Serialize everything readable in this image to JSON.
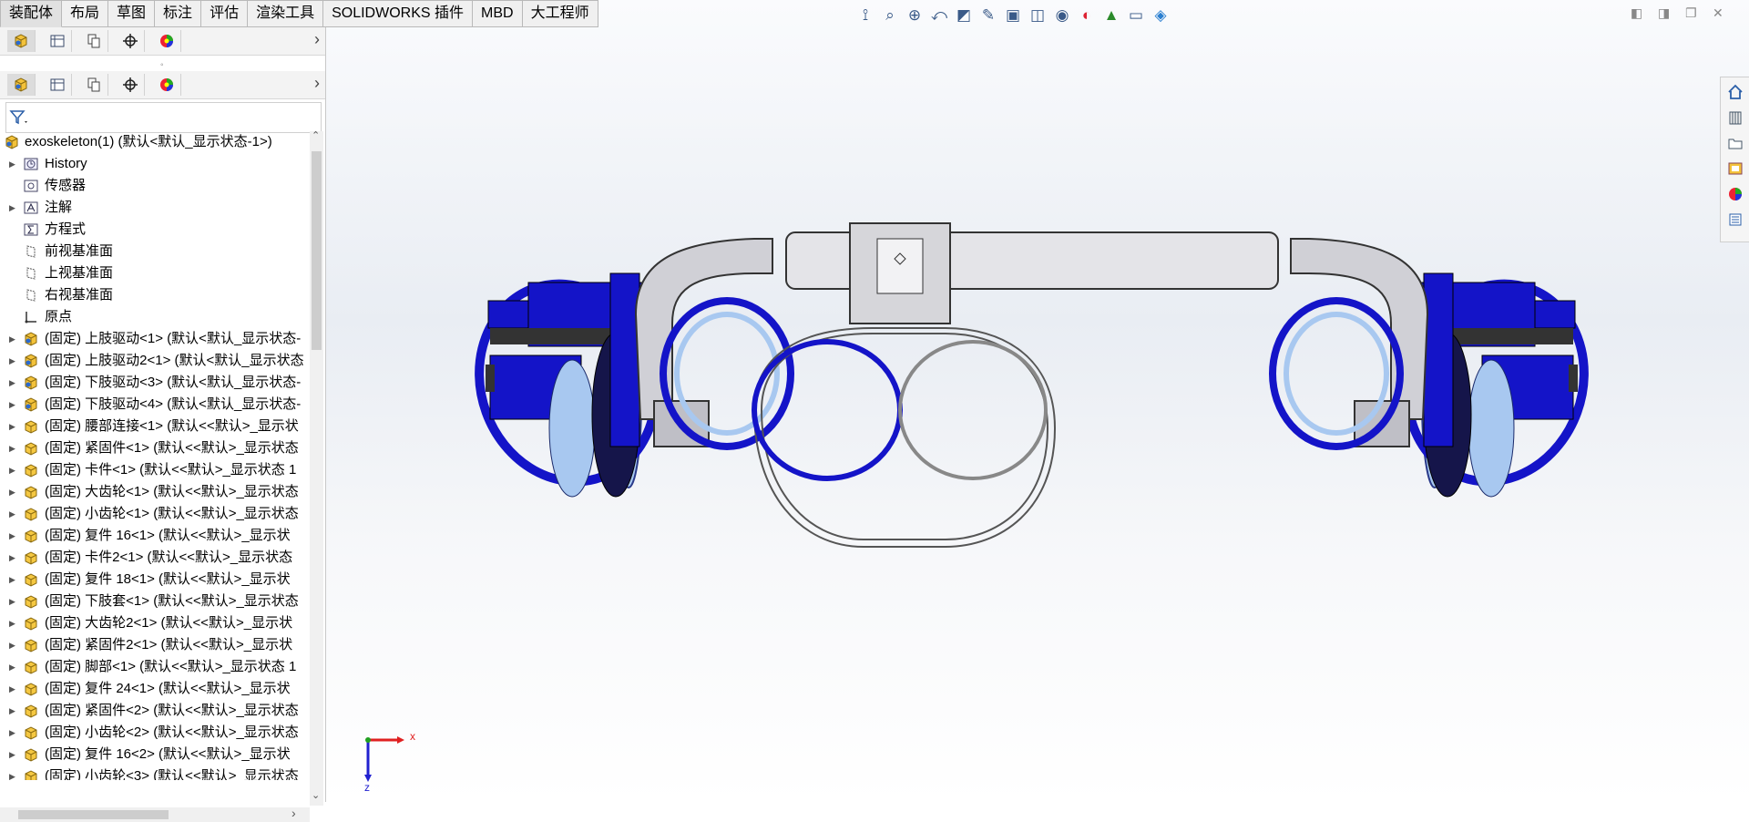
{
  "tabs": [
    "装配体",
    "布局",
    "草图",
    "标注",
    "评估",
    "渲染工具",
    "SOLIDWORKS 插件",
    "MBD",
    "大工程师"
  ],
  "manager_icons": [
    "feature-manager-icon",
    "property-manager-icon",
    "configuration-manager-icon",
    "dimxpert-icon",
    "display-manager-icon"
  ],
  "filter_icon": "filter-icon",
  "tree": {
    "root": "exoskeleton(1)  (默认<默认_显示状态-1>)",
    "items": [
      {
        "label": "History",
        "icon": "history-icon",
        "expand": true
      },
      {
        "label": "传感器",
        "icon": "sensor-icon",
        "expand": false
      },
      {
        "label": "注解",
        "icon": "annotation-icon",
        "expand": true
      },
      {
        "label": "方程式",
        "icon": "equation-icon",
        "expand": false
      },
      {
        "label": "前视基准面",
        "icon": "plane-icon",
        "expand": false
      },
      {
        "label": "上视基准面",
        "icon": "plane-icon",
        "expand": false
      },
      {
        "label": "右视基准面",
        "icon": "plane-icon",
        "expand": false
      },
      {
        "label": "原点",
        "icon": "origin-icon",
        "expand": false
      },
      {
        "label": "(固定) 上肢驱动<1> (默认<默认_显示状态-",
        "icon": "assembly-icon",
        "expand": true
      },
      {
        "label": "(固定) 上肢驱动2<1> (默认<默认_显示状态",
        "icon": "assembly-icon",
        "expand": true
      },
      {
        "label": "(固定) 下肢驱动<3> (默认<默认_显示状态-",
        "icon": "assembly-icon",
        "expand": true
      },
      {
        "label": "(固定) 下肢驱动<4> (默认<默认_显示状态-",
        "icon": "assembly-icon",
        "expand": true
      },
      {
        "label": "(固定) 腰部连接<1> (默认<<默认>_显示状",
        "icon": "part-icon",
        "expand": true
      },
      {
        "label": "(固定) 紧固件<1> (默认<<默认>_显示状态",
        "icon": "part-icon",
        "expand": true
      },
      {
        "label": "(固定) 卡件<1> (默认<<默认>_显示状态 1",
        "icon": "part-icon",
        "expand": true
      },
      {
        "label": "(固定) 大齿轮<1> (默认<<默认>_显示状态",
        "icon": "part-icon",
        "expand": true
      },
      {
        "label": "(固定) 小齿轮<1> (默认<<默认>_显示状态",
        "icon": "part-icon",
        "expand": true
      },
      {
        "label": "(固定) 复件 16<1> (默认<<默认>_显示状",
        "icon": "part-icon",
        "expand": true
      },
      {
        "label": "(固定) 卡件2<1> (默认<<默认>_显示状态",
        "icon": "part-icon",
        "expand": true
      },
      {
        "label": "(固定) 复件 18<1> (默认<<默认>_显示状",
        "icon": "part-icon",
        "expand": true
      },
      {
        "label": "(固定) 下肢套<1> (默认<<默认>_显示状态",
        "icon": "part-icon",
        "expand": true
      },
      {
        "label": "(固定) 大齿轮2<1> (默认<<默认>_显示状",
        "icon": "part-icon",
        "expand": true
      },
      {
        "label": "(固定) 紧固件2<1> (默认<<默认>_显示状",
        "icon": "part-icon",
        "expand": true
      },
      {
        "label": "(固定) 脚部<1> (默认<<默认>_显示状态 1",
        "icon": "part-icon",
        "expand": true
      },
      {
        "label": "(固定) 复件 24<1> (默认<<默认>_显示状",
        "icon": "part-icon",
        "expand": true
      },
      {
        "label": "(固定) 紧固件<2> (默认<<默认>_显示状态",
        "icon": "part-icon",
        "expand": true
      },
      {
        "label": "(固定) 小齿轮<2> (默认<<默认>_显示状态",
        "icon": "part-icon",
        "expand": true
      },
      {
        "label": "(固定) 复件 16<2> (默认<<默认>_显示状",
        "icon": "part-icon",
        "expand": true
      },
      {
        "label": "(固定) 小齿轮<3> (默认<<默认>_显示状态",
        "icon": "part-icon",
        "expand": true
      }
    ]
  },
  "heads_up_toolbar": [
    "view-orientation-icon",
    "zoom-to-fit-icon",
    "zoom-to-area-icon",
    "previous-view-icon",
    "section-view-icon",
    "dynamic-annotation-icon",
    "view-type-icon",
    "display-style-icon",
    "hide-show-items-icon",
    "edit-appearance-icon",
    "apply-scene-icon",
    "view-settings-icon",
    "cube-view-icon"
  ],
  "window_controls": [
    "restore-left-icon",
    "restore-right-icon",
    "restore-icon",
    "close-icon"
  ],
  "task_pane": [
    "home-icon",
    "design-library-icon",
    "file-explorer-icon",
    "view-palette-icon",
    "appearances-icon",
    "custom-properties-icon"
  ],
  "triad": {
    "x_label": "x",
    "z_label": "z"
  },
  "colors": {
    "part_blue": "#1414c8",
    "light_blue": "#a8c8f0",
    "steel": "#d8d8d8",
    "tab_bg": "#f0f0f0",
    "x_axis": "#e02020",
    "y_axis": "#20a020",
    "z_axis": "#2020d0"
  }
}
